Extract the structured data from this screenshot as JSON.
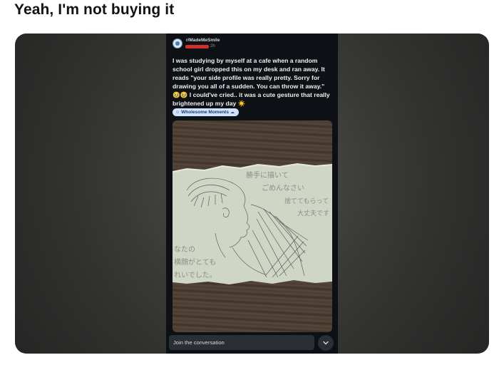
{
  "tweet": {
    "text": "Yeah, I'm not buying it"
  },
  "post": {
    "subreddit": "r/MadeMeSmile",
    "age": "2h",
    "body": "I was studying by myself at a cafe when a random school girl dropped this on my desk and ran away. It reads \"your side profile was really pretty. Sorry for drawing you all of a sudden. You can throw it away.\" 🥹🥹 I could've cried.. it was a cute gesture that really brightened up my day ☀️",
    "flair": "Wholesome Moments",
    "note_text": {
      "right_line1": "勝手に描いて",
      "right_line2": "ごめんなさい",
      "right_line3": "捨ててもらって",
      "right_line4": "大丈夫です",
      "left_line1": "なたの",
      "left_line2": "横顔がとても",
      "left_line3": "れいでした。"
    }
  },
  "comment_bar": {
    "placeholder": "Join the conversation"
  },
  "colors": {
    "redaction": "#d0302a",
    "flair_bg": "#cfe3ff",
    "app_bg": "#0d1014"
  }
}
